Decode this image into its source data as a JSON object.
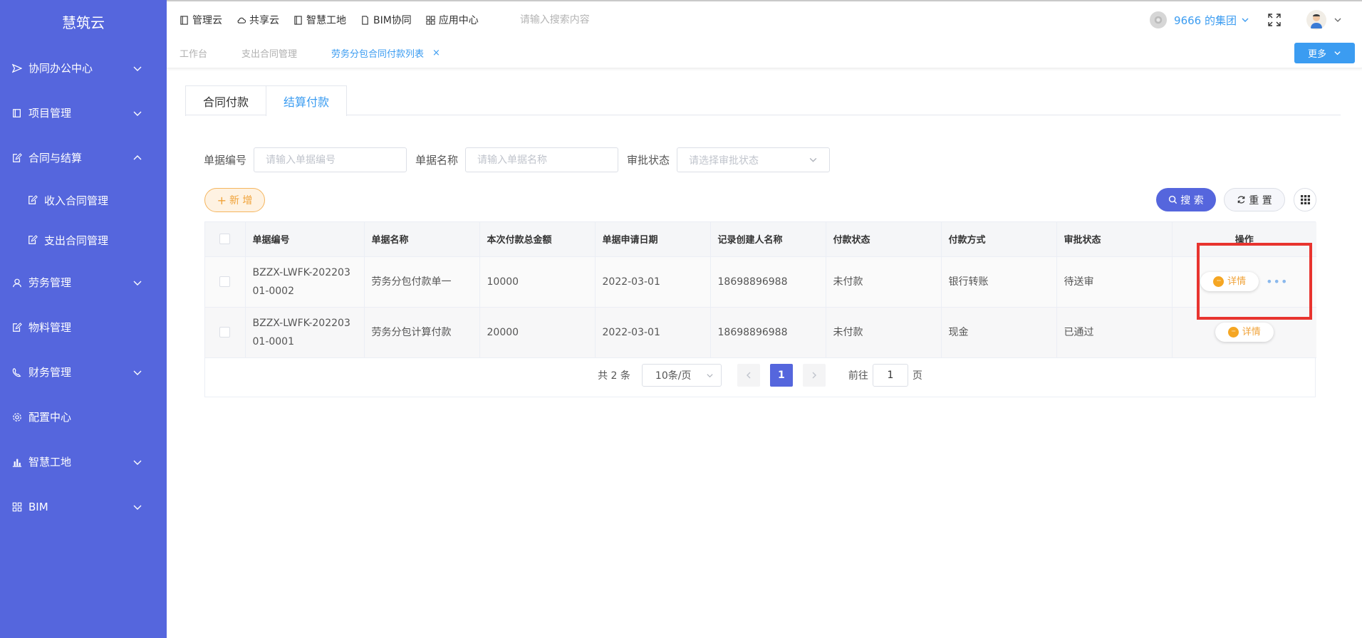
{
  "sidebar": {
    "logo": "慧筑云",
    "items": [
      {
        "label": "协同办公中心",
        "icon": "send-icon",
        "expandable": true
      },
      {
        "label": "项目管理",
        "icon": "book-icon",
        "expandable": true
      },
      {
        "label": "合同与结算",
        "icon": "edit-doc-icon",
        "expandable": true,
        "expanded": true
      },
      {
        "label": "收入合同管理",
        "icon": "edit-doc-icon",
        "sub": true
      },
      {
        "label": "支出合同管理",
        "icon": "edit-doc-icon",
        "sub": true
      },
      {
        "label": "劳务管理",
        "icon": "worker-icon",
        "expandable": true
      },
      {
        "label": "物料管理",
        "icon": "edit-doc-icon",
        "expandable": false
      },
      {
        "label": "财务管理",
        "icon": "finance-icon",
        "expandable": true
      },
      {
        "label": "配置中心",
        "icon": "gear-icon",
        "expandable": false
      },
      {
        "label": "智慧工地",
        "icon": "bar-chart-icon",
        "expandable": true
      },
      {
        "label": "BIM",
        "icon": "grid-icon",
        "expandable": true
      }
    ]
  },
  "topbar": {
    "nav": [
      {
        "label": "管理云",
        "icon": "book-icon"
      },
      {
        "label": "共享云",
        "icon": "cloud-icon"
      },
      {
        "label": "智慧工地",
        "icon": "book-icon"
      },
      {
        "label": "BIM协同",
        "icon": "doc-icon"
      },
      {
        "label": "应用中心",
        "icon": "grid-icon"
      }
    ],
    "search_placeholder": "请输入搜索内容",
    "org_name": "9666 的集团"
  },
  "page_tabs": [
    {
      "label": "工作台",
      "active": false
    },
    {
      "label": "支出合同管理",
      "active": false
    },
    {
      "label": "劳务分包合同付款列表",
      "active": true,
      "closable": true,
      "close_label": "×"
    }
  ],
  "more_button": "更多",
  "subtabs": [
    {
      "label": "合同付款",
      "active": false
    },
    {
      "label": "结算付款",
      "active": true
    }
  ],
  "filters": {
    "doc_no_label": "单据编号",
    "doc_no_placeholder": "请输入单据编号",
    "doc_name_label": "单据名称",
    "doc_name_placeholder": "请输入单据名称",
    "approval_label": "审批状态",
    "approval_placeholder": "请选择审批状态"
  },
  "buttons": {
    "add": "新 增",
    "add_icon": "+",
    "search": "搜 索",
    "reset": "重 置"
  },
  "table": {
    "columns": [
      "单据编号",
      "单据名称",
      "本次付款总金额",
      "单据申请日期",
      "记录创建人名称",
      "付款状态",
      "付款方式",
      "审批状态",
      "操作"
    ],
    "rows": [
      {
        "doc_no": "BZZX-LWFK-20220301-0002",
        "doc_name": "劳务分包付款单一",
        "amount": "10000",
        "date": "2022-03-01",
        "creator": "18698896988",
        "pay_status": "未付款",
        "pay_method": "银行转账",
        "approval": "待送审",
        "has_more": true
      },
      {
        "doc_no": "BZZX-LWFK-20220301-0001",
        "doc_name": "劳务分包计算付款",
        "amount": "20000",
        "date": "2022-03-01",
        "creator": "18698896988",
        "pay_status": "未付款",
        "pay_method": "现金",
        "approval": "已通过",
        "has_more": false
      }
    ],
    "detail_label": "详情",
    "detail_icon": "···",
    "more_label": "•••"
  },
  "pagination": {
    "total_text": "共 2 条",
    "page_size": "10条/页",
    "current_page": "1",
    "goto_label": "前往",
    "goto_value": "1",
    "page_suffix": "页"
  },
  "colors": {
    "sidebar_bg": "#5566dd",
    "accent": "#3b9cf1",
    "orange": "#f0a33a",
    "highlight": "#e8342f"
  }
}
